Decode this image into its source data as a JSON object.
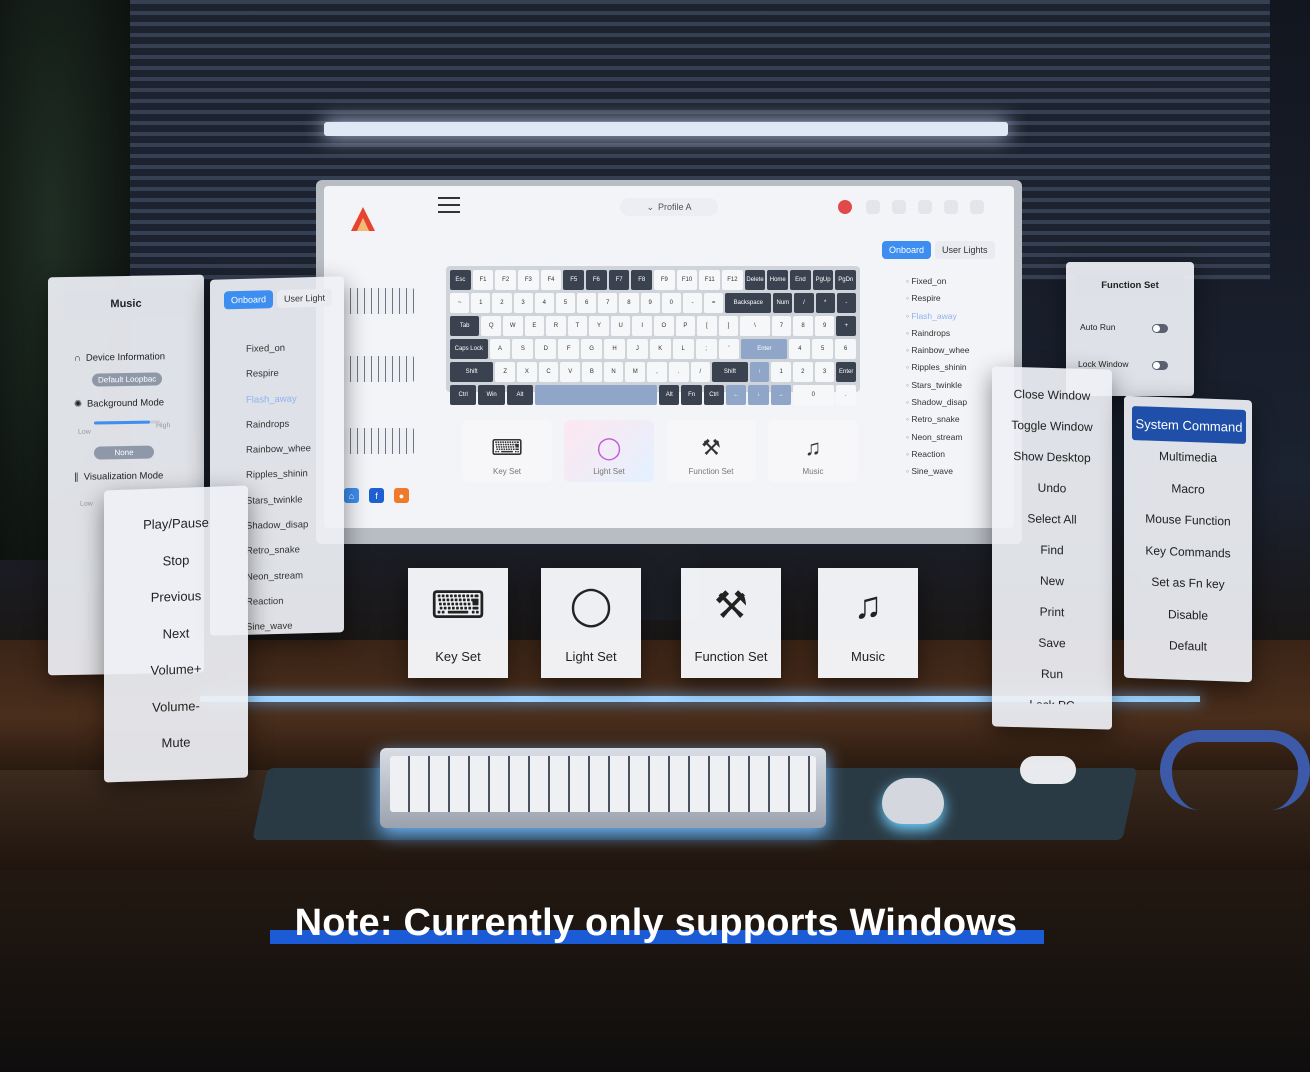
{
  "profile": {
    "label": "Profile A"
  },
  "tabs": [
    {
      "label": "Onboard"
    },
    {
      "label": "User Lights"
    }
  ],
  "screen_keyboard_rows": [
    [
      "Esc",
      "F1",
      "F2",
      "F3",
      "F4",
      "F5",
      "F6",
      "F7",
      "F8",
      "F9",
      "F10",
      "F11",
      "F12",
      "Delete",
      "Home",
      "End",
      "PgUp",
      "PgDn"
    ],
    [
      "~",
      "1",
      "2",
      "3",
      "4",
      "5",
      "6",
      "7",
      "8",
      "9",
      "0",
      "-",
      "=",
      "Backspace",
      "Num",
      "/",
      "*",
      "-"
    ],
    [
      "Tab",
      "Q",
      "W",
      "E",
      "R",
      "T",
      "Y",
      "U",
      "I",
      "O",
      "P",
      "[",
      "]",
      "\\",
      "7",
      "8",
      "9",
      "+"
    ],
    [
      "Caps Lock",
      "A",
      "S",
      "D",
      "F",
      "G",
      "H",
      "J",
      "K",
      "L",
      ";",
      "'",
      "Enter",
      "4",
      "5",
      "6"
    ],
    [
      "Shift",
      "Z",
      "X",
      "C",
      "V",
      "B",
      "N",
      "M",
      ",",
      ".",
      "/",
      "Shift",
      "↑",
      "1",
      "2",
      "3",
      "Enter"
    ],
    [
      "Ctrl",
      "Win",
      "Alt",
      "",
      "Alt",
      "Fn",
      "Ctrl",
      "←",
      "↓",
      "→",
      "0",
      "."
    ]
  ],
  "screen_tiles": [
    {
      "label": "Key Set",
      "icon": "keyboard-icon"
    },
    {
      "label": "Light Set",
      "icon": "ring-icon"
    },
    {
      "label": "Function Set",
      "icon": "tools-icon"
    },
    {
      "label": "Music",
      "icon": "music-icon"
    }
  ],
  "light_effects": [
    "Fixed_on",
    "Respire",
    "Flash_away",
    "Raindrops",
    "Rainbow_whee",
    "Ripples_shinin",
    "Stars_twinkle",
    "Shadow_disap",
    "Retro_snake",
    "Neon_stream",
    "Reaction",
    "Sine_wave"
  ],
  "music_panel": {
    "title": "Music",
    "device_information": "Device Information",
    "default_loopback": "Default Loopbac",
    "background_mode": "Background Mode",
    "low": "Low",
    "high": "High",
    "none": "None",
    "visualization_mode": "Visualization Mode",
    "low2": "Low"
  },
  "fx_panel": {
    "tab_onboard": "Onboard",
    "tab_user": "User Light",
    "effects": [
      "Fixed_on",
      "Respire",
      "Flash_away",
      "Raindrops",
      "Rainbow_whee",
      "Ripples_shinin",
      "Stars_twinkle",
      "Shadow_disap",
      "Retro_snake",
      "Neon_stream",
      "Reaction",
      "Sine_wave"
    ]
  },
  "media_panel": {
    "items": [
      "Play/Pause",
      "Stop",
      "Previous",
      "Next",
      "Volume+",
      "Volume-",
      "Mute"
    ]
  },
  "function_panel": {
    "title": "Function Set",
    "auto_run": "Auto Run",
    "lock_window": "Lock Window"
  },
  "window_panel": {
    "items": [
      "Close Window",
      "Toggle Window",
      "Show Desktop",
      "Undo",
      "Select All",
      "Find",
      "New",
      "Print",
      "Save",
      "Run",
      "Lock PC"
    ]
  },
  "system_panel": {
    "header": "System Command",
    "items": [
      "Multimedia",
      "Macro",
      "Mouse Function",
      "Key Commands",
      "Set as Fn key",
      "Disable",
      "Default"
    ]
  },
  "cards": [
    {
      "label": "Key Set",
      "icon": "keyboard-icon"
    },
    {
      "label": "Light Set",
      "icon": "ring-icon"
    },
    {
      "label": "Function Set",
      "icon": "tools-icon"
    },
    {
      "label": "Music",
      "icon": "music-icon"
    }
  ],
  "note": "Note: Currently only supports Windows",
  "colors": {
    "accent": "#3d8ef0",
    "system_header": "#1f4fa8",
    "note_underline": "#1c5bd6"
  }
}
